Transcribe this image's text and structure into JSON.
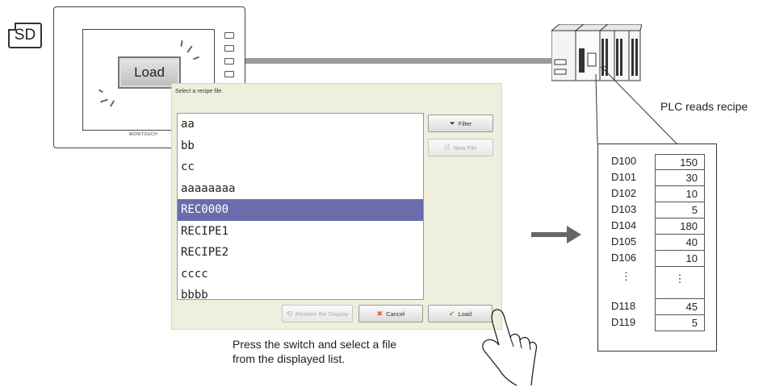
{
  "sd_label": "SD",
  "hmi": {
    "load_button": "Load",
    "brand": "MONITOUCH"
  },
  "plc": {
    "label": "PLC reads recipe"
  },
  "registers": [
    {
      "name": "D100",
      "value": "150"
    },
    {
      "name": "D101",
      "value": "30"
    },
    {
      "name": "D102",
      "value": "10"
    },
    {
      "name": "D103",
      "value": "5"
    },
    {
      "name": "D104",
      "value": "180"
    },
    {
      "name": "D105",
      "value": "40"
    },
    {
      "name": "D106",
      "value": "10"
    },
    {
      "name": "⋮",
      "value": "⋮"
    },
    {
      "name": "D118",
      "value": "45"
    },
    {
      "name": "D119",
      "value": "5"
    }
  ],
  "dialog": {
    "title": "Select a recipe file.",
    "files": [
      "aa",
      "bb",
      "cc",
      "aaaaaaaa",
      "REC0000",
      "RECIPE1",
      "RECIPE2",
      "cccc",
      "bbbb"
    ],
    "selected_index": 4,
    "filter_label": "Filter",
    "new_file_label": "New File",
    "restore_label": "Restore the Display",
    "cancel_label": "Cancel",
    "load_label": "Load"
  },
  "caption": {
    "line1": "Press the switch and select a file",
    "line2": "from the displayed list."
  },
  "colors": {
    "selection": "#6a6dab",
    "cable": "#9a9a9a",
    "dialog_bg": "#efefde",
    "cancel_icon": "#e0623a",
    "load_icon": "#58b43a"
  }
}
